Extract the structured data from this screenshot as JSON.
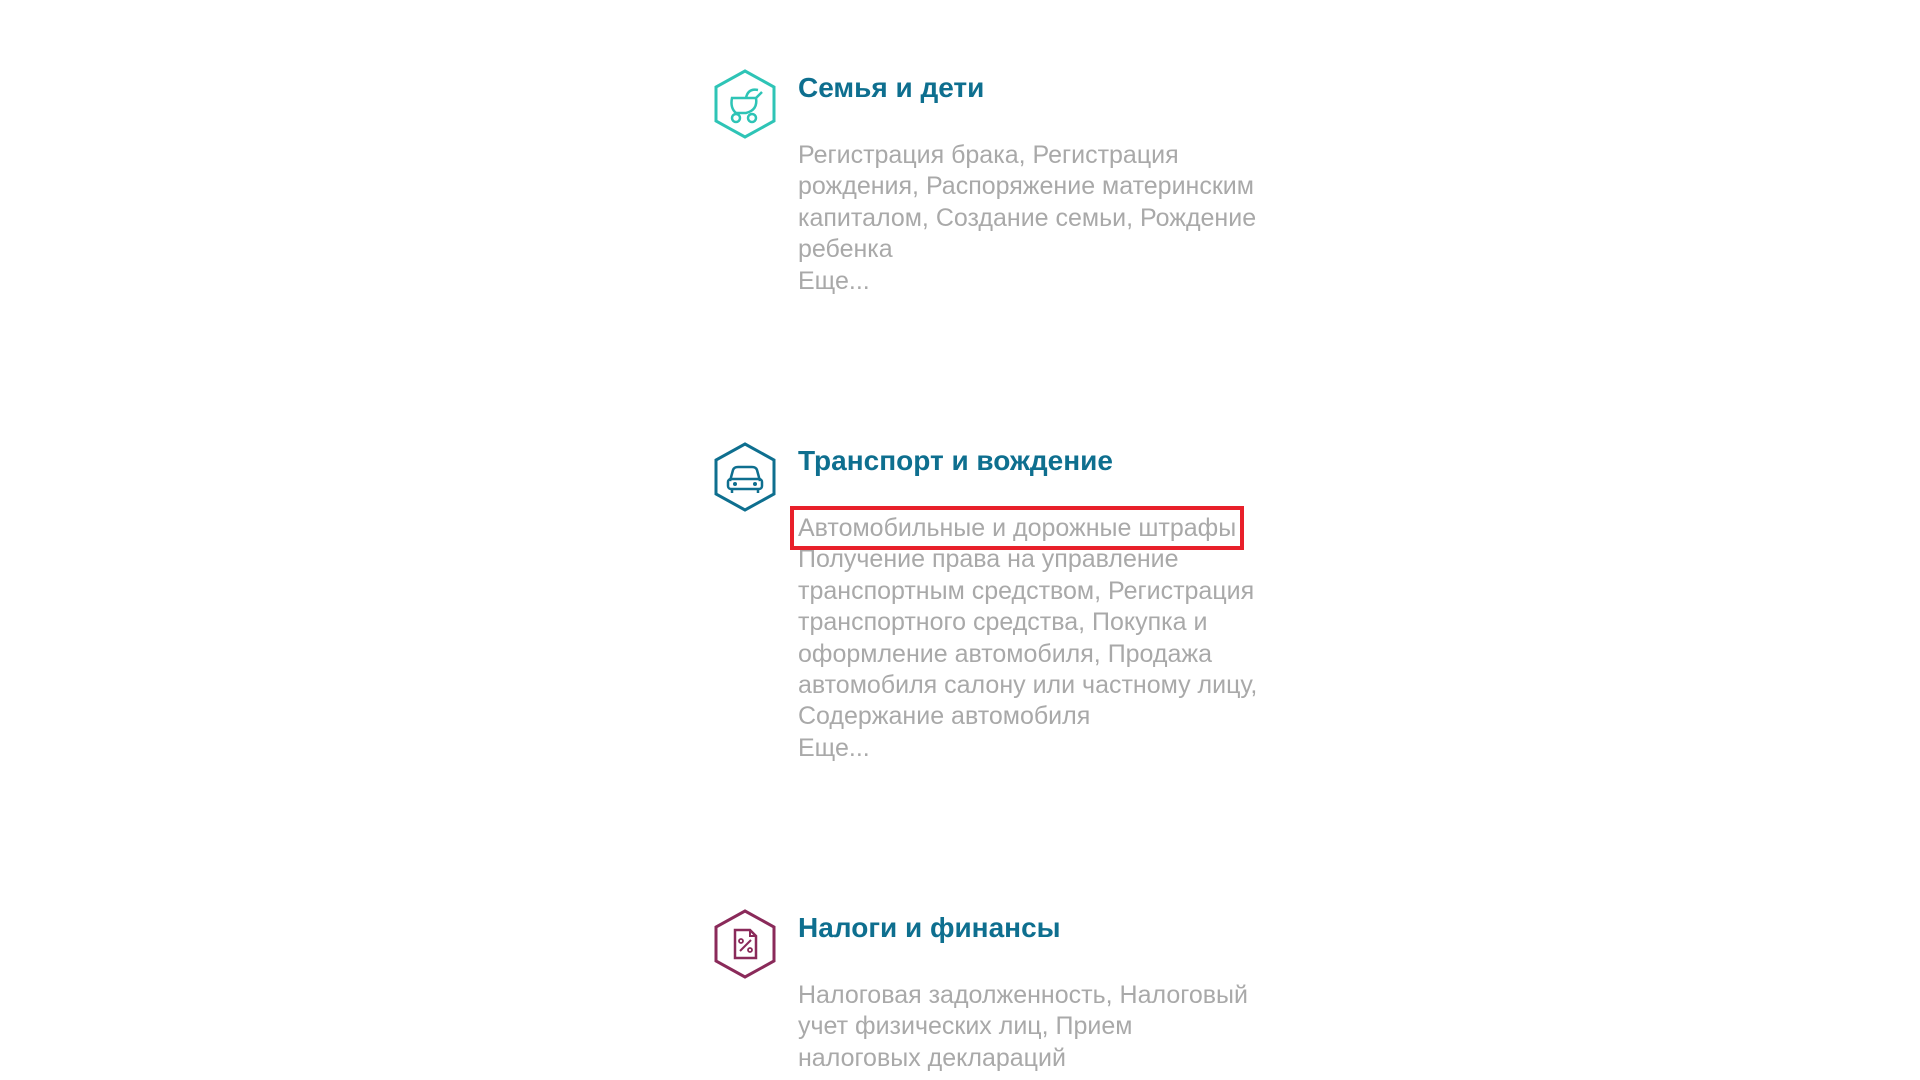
{
  "categories": [
    {
      "id": "family",
      "title": "Семья и дети",
      "icon": "baby-stroller-icon",
      "color": "#2ec4b6",
      "links": [
        "Регистрация брака,",
        "Регистрация рождения,",
        "Распоряжение материнским капиталом,",
        "Создание семьи,",
        "Рождение ребенка"
      ],
      "more": "Еще..."
    },
    {
      "id": "transport",
      "title": "Транспорт и вождение",
      "icon": "car-icon",
      "color": "#0e6f8f",
      "links": [
        "Автомобильные и дорожные штрафы",
        "Получение права на управление транспортным средством,",
        "Регистрация транспортного средства,",
        "Покупка и оформление автомобиля,",
        "Продажа автомобиля салону или частному лицу,",
        "Содержание автомобиля"
      ],
      "highlighted_link": "Автомобильные и дорожные штрафы",
      "more": "Еще..."
    },
    {
      "id": "taxes",
      "title": "Налоги и финансы",
      "icon": "tax-document-icon",
      "color": "#8a2a5a",
      "links": [
        "Налоговая задолженность,",
        "Налоговый учет физических лиц,",
        "Прием налоговых деклараций"
      ]
    }
  ],
  "highlight_color": "#e8202a"
}
